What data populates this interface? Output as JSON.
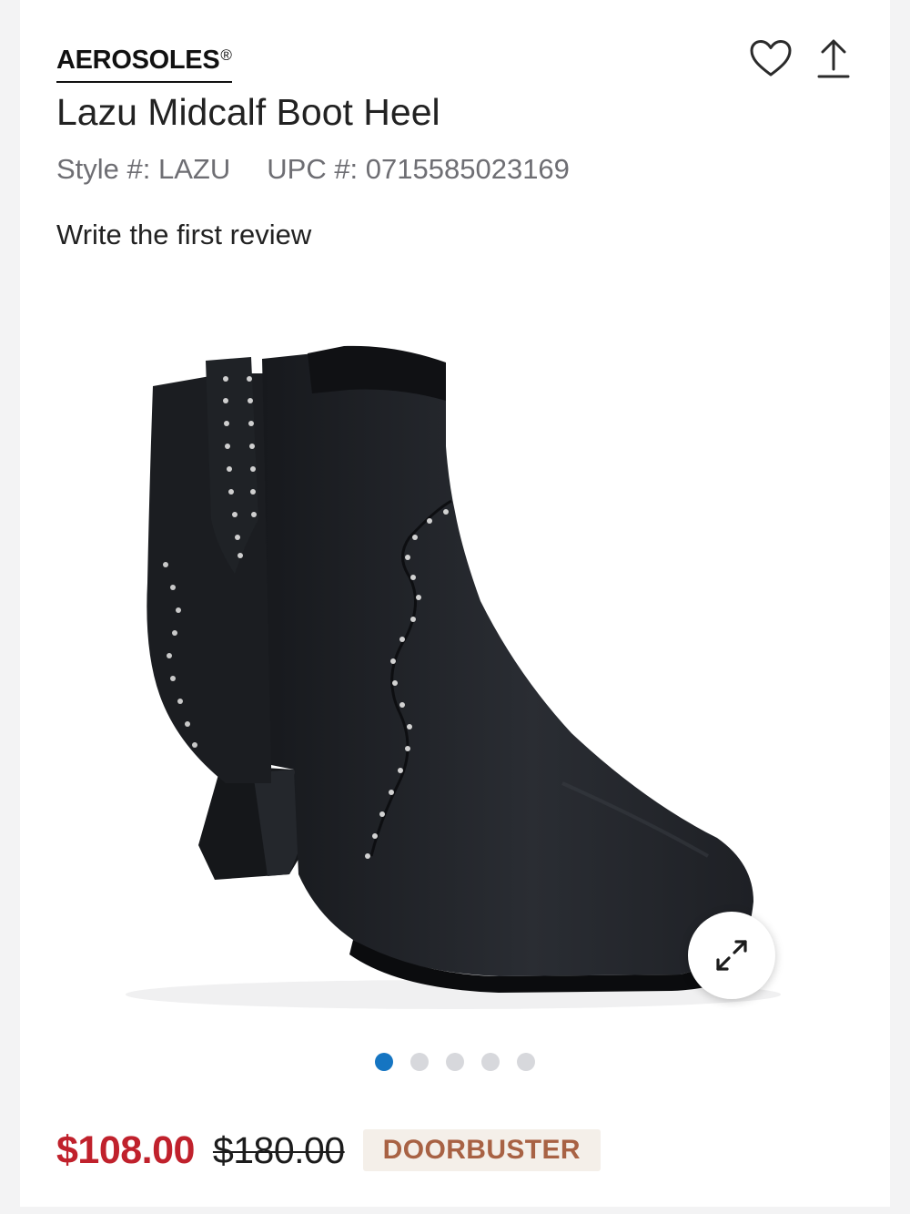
{
  "product": {
    "brand": "AEROSOLES",
    "brand_mark": "®",
    "name": "Lazu Midcalf Boot Heel",
    "style_label": "Style #: LAZU",
    "upc_label": "UPC #: 0715585023169",
    "review_link": "Write the first review"
  },
  "gallery": {
    "image_subject": "black studded western ankle boot",
    "slide_count": 5,
    "active_slide": 1
  },
  "pricing": {
    "sale_price": "$108.00",
    "original_price": "$180.00",
    "badge": "DOORBUSTER"
  },
  "icons": {
    "favorite": "heart-icon",
    "share": "share-icon",
    "expand": "expand-icon"
  },
  "colors": {
    "sale": "#c0212c",
    "active_dot": "#1575c2",
    "badge_text": "#a86244",
    "badge_bg": "#f4efe9"
  }
}
